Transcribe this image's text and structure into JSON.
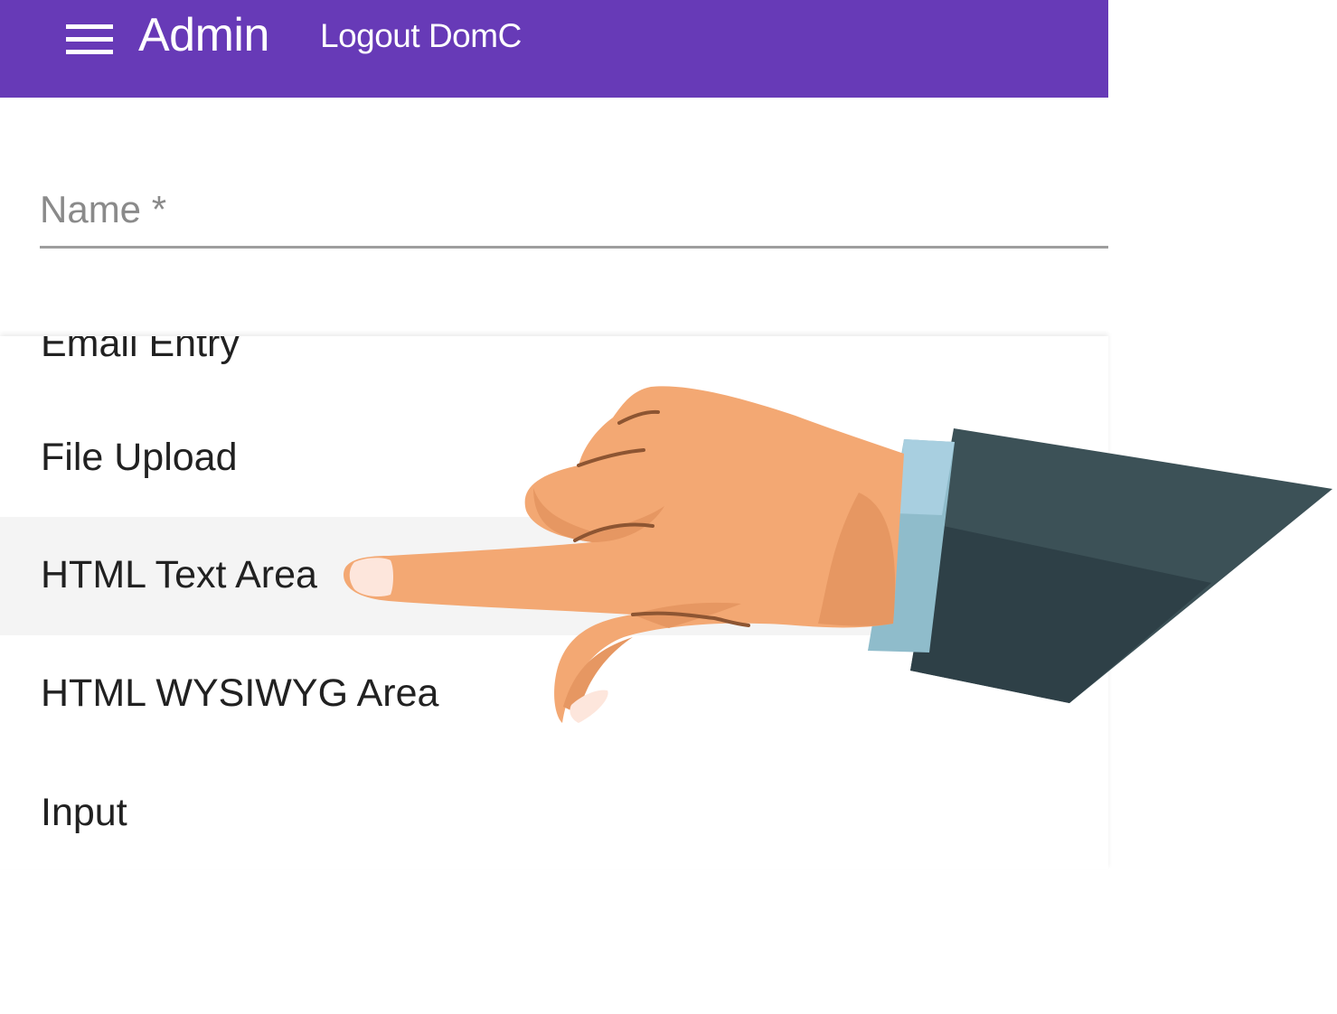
{
  "app_bar": {
    "title": "Admin",
    "logout_link": "Logout DomC",
    "menu_icon": "menu-icon",
    "background_color": "#673ab7"
  },
  "form": {
    "name_field": {
      "label": "Name *",
      "value": ""
    }
  },
  "dropdown": {
    "options": [
      {
        "label": "Email Entry",
        "partially_hidden": true
      },
      {
        "label": "File Upload"
      },
      {
        "label": "HTML Text Area",
        "highlighted": true
      },
      {
        "label": "HTML WYSIWYG Area"
      },
      {
        "label": "Input"
      }
    ]
  },
  "overlay": {
    "icon": "pointing-hand-icon",
    "colors": {
      "skin": "#f3a873",
      "skin_shadow": "#e69762",
      "crease": "#8d5532",
      "cuff": "#a8cfe0",
      "sleeve": "#3c5157",
      "sleeve_shadow": "#2e4047"
    }
  }
}
